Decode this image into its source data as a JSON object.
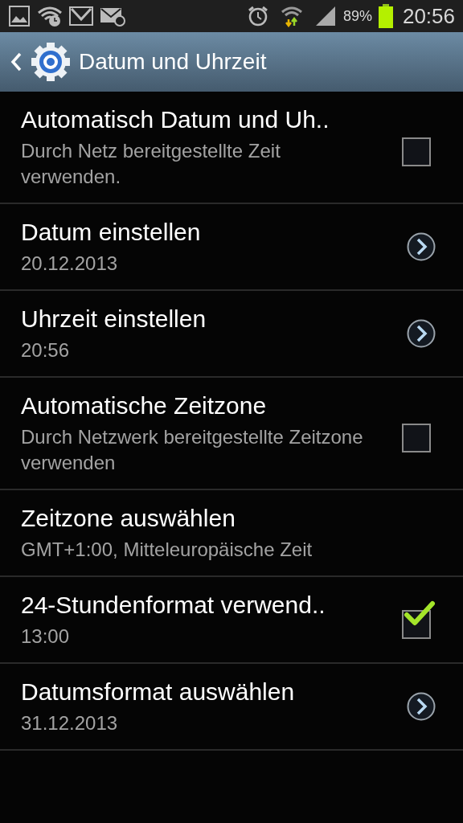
{
  "status_bar": {
    "battery": "89%",
    "time": "20:56"
  },
  "header": {
    "title": "Datum und Uhrzeit"
  },
  "rows": [
    {
      "kind": "checkbox",
      "title": "Automatisch Datum und Uh..",
      "subtitle": "Durch Netz bereitgestellte Zeit verwenden.",
      "checked": false
    },
    {
      "kind": "arrow",
      "title": "Datum einstellen",
      "subtitle": "20.12.2013"
    },
    {
      "kind": "arrow",
      "title": "Uhrzeit einstellen",
      "subtitle": "20:56"
    },
    {
      "kind": "checkbox",
      "title": "Automatische Zeitzone",
      "subtitle": "Durch Netzwerk bereitgestellte Zeitzone verwenden",
      "checked": false
    },
    {
      "kind": "plain",
      "title": "Zeitzone auswählen",
      "subtitle": "GMT+1:00, Mitteleuropäische Zeit"
    },
    {
      "kind": "checkbox",
      "title": "24-Stundenformat verwend..",
      "subtitle": "13:00",
      "checked": true
    },
    {
      "kind": "arrow",
      "title": "Datumsformat auswählen",
      "subtitle": "31.12.2013"
    }
  ]
}
